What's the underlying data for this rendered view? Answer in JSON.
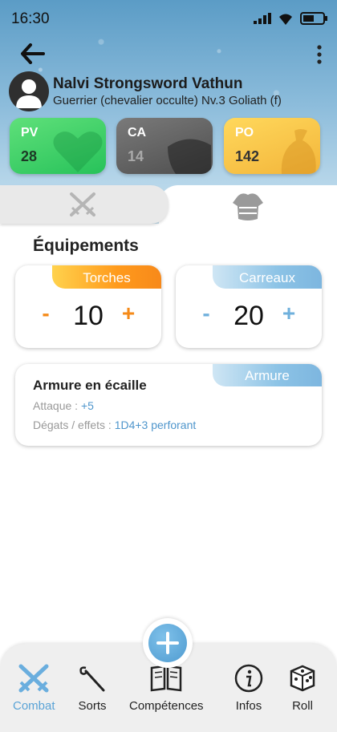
{
  "status": {
    "time": "16:30"
  },
  "character": {
    "name": "Nalvi Strongsword Vathun",
    "subtitle": "Guerrier (chevalier occulte) Nv.3 Goliath (f)"
  },
  "stats": [
    {
      "label": "PV",
      "value": "28"
    },
    {
      "label": "CA",
      "value": "14"
    },
    {
      "label": "PO",
      "value": "142"
    }
  ],
  "tabs": {
    "left_icon": "crossed-swords-icon",
    "right_icon": "armor-icon"
  },
  "section": {
    "title": "Équipements"
  },
  "counters": [
    {
      "label": "Torches",
      "minus": "-",
      "value": "10",
      "plus": "+",
      "color": "#f58a18"
    },
    {
      "label": "Carreaux",
      "minus": "-",
      "value": "20",
      "plus": "+",
      "color": "#6fb0dc"
    }
  ],
  "item": {
    "tag": "Armure",
    "name": "Armure en écaille",
    "attack_label": "Attaque :",
    "attack_value": "+5",
    "damage_label": "Dégats / effets :",
    "damage_value": "1D4+3 perforant"
  },
  "fab": {
    "icon": "plus-icon"
  },
  "nav": [
    {
      "label": "Combat",
      "icon": "crossed-swords-icon",
      "active": true
    },
    {
      "label": "Sorts",
      "icon": "wand-icon"
    },
    {
      "label": "Compétences",
      "icon": "book-icon"
    },
    {
      "label": "Infos",
      "icon": "info-icon"
    },
    {
      "label": "Roll",
      "icon": "dice-icon"
    }
  ]
}
